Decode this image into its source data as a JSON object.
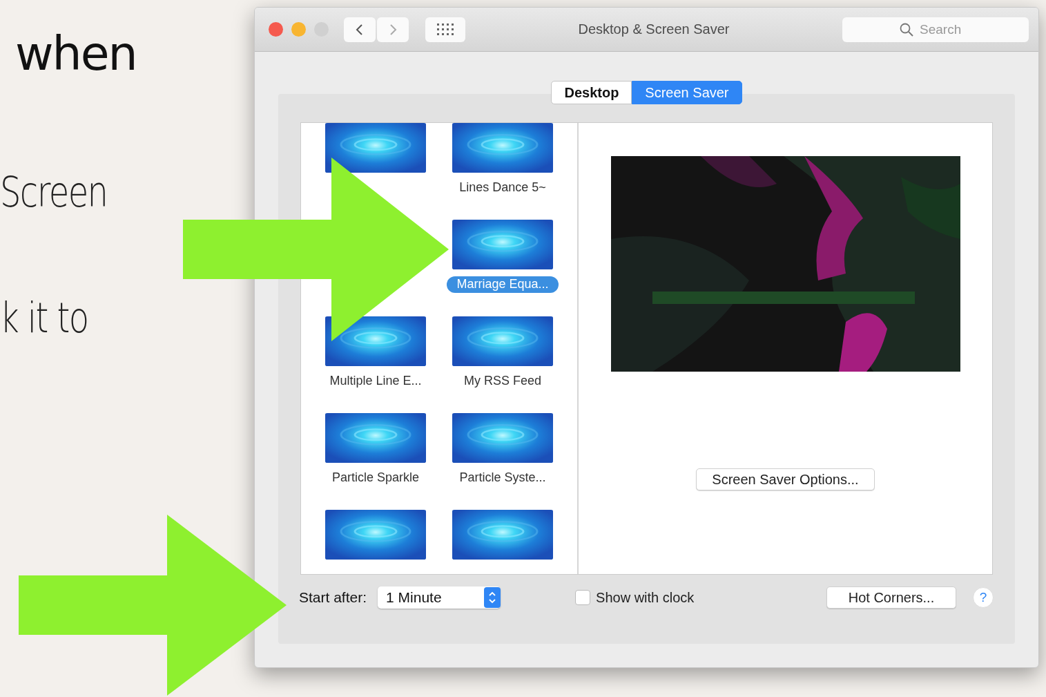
{
  "slide": {
    "lines": [
      {
        "text": "when",
        "kind": "heading"
      },
      {
        "text": "Screen",
        "kind": "body"
      },
      {
        "text": "k it to",
        "kind": "body"
      }
    ]
  },
  "window": {
    "title": "Desktop & Screen Saver",
    "search": {
      "placeholder": "Search"
    }
  },
  "tabs": [
    {
      "label": "Desktop",
      "selected": false
    },
    {
      "label": "Screen Saver",
      "selected": true
    }
  ],
  "savers": [
    {
      "selected": false
    },
    {
      "label": "Lines Dance 5~",
      "selected": false
    },
    {
      "selected": false
    },
    {
      "label": "Marriage Equa...",
      "selected": true
    },
    {
      "label": "Multiple Line E...",
      "selected": false
    },
    {
      "label": "My RSS Feed",
      "selected": false
    },
    {
      "label": "Particle Sparkle",
      "selected": false
    },
    {
      "label": "Particle Syste...",
      "selected": false
    },
    {
      "selected": false
    },
    {
      "selected": false
    }
  ],
  "preview": {
    "kind": "picture",
    "options_button": "Screen Saver Options..."
  },
  "bottom": {
    "start_after_label": "Start after:",
    "start_after_value": "1 Minute",
    "show_clock": {
      "label": "Show with clock",
      "checked": false
    },
    "hot_corners": "Hot Corners...",
    "help": "?"
  }
}
